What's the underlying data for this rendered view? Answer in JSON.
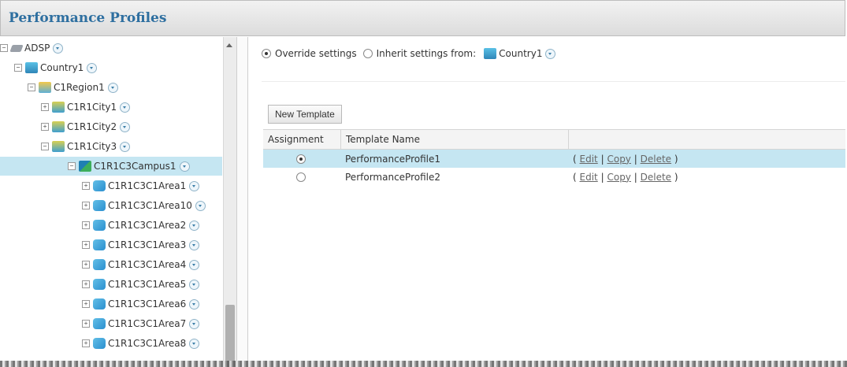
{
  "header": {
    "title": "Performance Profiles"
  },
  "tree": {
    "nodes": [
      {
        "label": "ADSP",
        "icon": "adsp-icon",
        "expander": "−"
      },
      {
        "label": "Country1",
        "icon": "country-icon",
        "expander": "−"
      },
      {
        "label": "C1Region1",
        "icon": "region-icon",
        "expander": "−"
      },
      {
        "label": "C1R1City1",
        "icon": "city-icon",
        "expander": "+"
      },
      {
        "label": "C1R1City2",
        "icon": "city-icon",
        "expander": "+"
      },
      {
        "label": "C1R1City3",
        "icon": "city-icon",
        "expander": "−"
      },
      {
        "label": "C1R1C3Campus1",
        "icon": "campus-icon",
        "expander": "−",
        "selected": true
      },
      {
        "label": "C1R1C3C1Area1",
        "icon": "area-icon",
        "expander": "+"
      },
      {
        "label": "C1R1C3C1Area10",
        "icon": "area-icon",
        "expander": "+"
      },
      {
        "label": "C1R1C3C1Area2",
        "icon": "area-icon",
        "expander": "+"
      },
      {
        "label": "C1R1C3C1Area3",
        "icon": "area-icon",
        "expander": "+"
      },
      {
        "label": "C1R1C3C1Area4",
        "icon": "area-icon",
        "expander": "+"
      },
      {
        "label": "C1R1C3C1Area5",
        "icon": "area-icon",
        "expander": "+"
      },
      {
        "label": "C1R1C3C1Area6",
        "icon": "area-icon",
        "expander": "+"
      },
      {
        "label": "C1R1C3C1Area7",
        "icon": "area-icon",
        "expander": "+"
      },
      {
        "label": "C1R1C3C1Area8",
        "icon": "area-icon",
        "expander": "+"
      }
    ]
  },
  "settings": {
    "override_label": "Override settings",
    "override_selected": true,
    "inherit_label": "Inherit settings from:",
    "inherit_source": "Country1"
  },
  "toolbar": {
    "new_template_label": "New Template"
  },
  "grid": {
    "columns": [
      "Assignment",
      "Template Name",
      ""
    ],
    "rows": [
      {
        "assigned": true,
        "name": "PerformanceProfile1",
        "selected": true
      },
      {
        "assigned": false,
        "name": "PerformanceProfile2",
        "selected": false
      }
    ],
    "actions": {
      "open": "(",
      "edit": "Edit",
      "sep": "|",
      "copy": "Copy",
      "delete": "Delete",
      "close": ")"
    }
  },
  "colors": {
    "accent": "#2e6fa0",
    "selection": "#c5e6f2"
  }
}
